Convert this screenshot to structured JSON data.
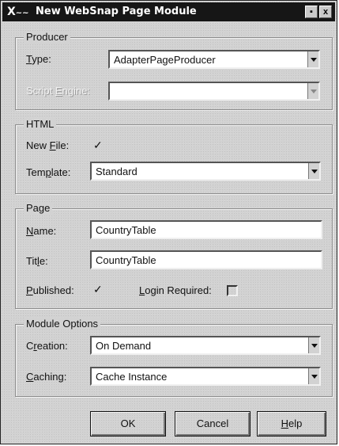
{
  "window": {
    "title": "New WebSnap Page Module",
    "logo": "X",
    "controls": {
      "menu": "▪",
      "close": "x"
    }
  },
  "producer": {
    "group_title": "Producer",
    "type_label_pre": "",
    "type_label_mnemonic": "T",
    "type_label_post": "ype:",
    "type_value": "AdapterPageProducer",
    "script_label_pre": "Script ",
    "script_label_mnemonic": "E",
    "script_label_post": "ngine:",
    "script_value": ""
  },
  "html": {
    "group_title": "HTML",
    "newfile_label_pre": "New ",
    "newfile_label_mnemonic": "F",
    "newfile_label_post": "ile:",
    "newfile_checked": "✓",
    "template_label_pre": "Tem",
    "template_label_mnemonic": "p",
    "template_label_post": "late:",
    "template_value": "Standard"
  },
  "page": {
    "group_title": "Page",
    "name_label_mnemonic": "N",
    "name_label_post": "ame:",
    "name_value": "CountryTable",
    "title_label_pre": "Tit",
    "title_label_mnemonic": "l",
    "title_label_post": "e:",
    "title_value": "CountryTable",
    "published_label_mnemonic": "P",
    "published_label_post": "ublished:",
    "published_checked": "✓",
    "login_label_mnemonic": "L",
    "login_label_post": "ogin Required:"
  },
  "module": {
    "group_title": "Module Options",
    "creation_label_pre": "C",
    "creation_label_mnemonic": "r",
    "creation_label_post": "eation:",
    "creation_value": "On Demand",
    "caching_label_mnemonic": "C",
    "caching_label_post": "aching:",
    "caching_value": "Cache Instance"
  },
  "buttons": {
    "ok": "OK",
    "cancel": "Cancel",
    "help_mnemonic": "H",
    "help_post": "elp"
  }
}
